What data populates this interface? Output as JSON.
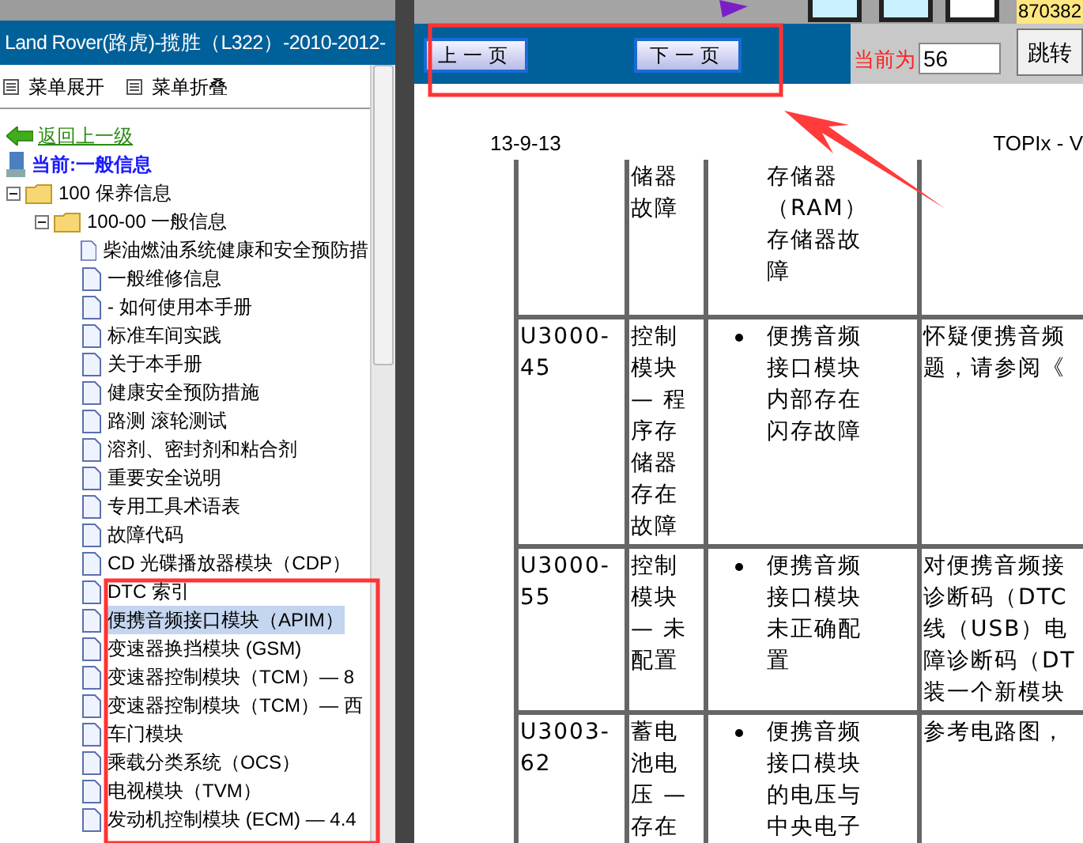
{
  "window": {
    "title": "Land Rover(路虎)-揽胜（L322）-2010-2012-"
  },
  "menu": [
    {
      "label": "菜单展开"
    },
    {
      "label": "菜单折叠"
    }
  ],
  "back_link": "返回上一级",
  "current": "当前:一般信息",
  "tree": [
    {
      "label": "100 保养信息",
      "expanded": true,
      "children": [
        {
          "label": "100-00 一般信息",
          "expanded": true,
          "children": [
            {
              "label": "柴油燃油系统健康和安全预防措",
              "selected": false
            },
            {
              "label": "一般维修信息",
              "selected": false
            },
            {
              "label": "- 如何使用本手册",
              "selected": false
            },
            {
              "label": "标准车间实践",
              "selected": false
            },
            {
              "label": "关于本手册",
              "selected": false
            },
            {
              "label": "健康安全预防措施",
              "selected": false
            },
            {
              "label": "路测 滚轮测试",
              "selected": false
            },
            {
              "label": "溶剂、密封剂和粘合剂",
              "selected": false
            },
            {
              "label": "重要安全说明",
              "selected": false
            },
            {
              "label": "专用工具术语表",
              "selected": false
            },
            {
              "label": "故障代码",
              "selected": false
            },
            {
              "label": "CD 光碟播放器模块（CDP）",
              "selected": false
            },
            {
              "label": "DTC 索引",
              "selected": false
            },
            {
              "label": "便携音频接口模块（APIM）",
              "selected": true
            },
            {
              "label": "变速器换挡模块 (GSM)",
              "selected": false
            },
            {
              "label": "变速器控制模块（TCM）— 8",
              "selected": false
            },
            {
              "label": "变速器控制模块（TCM）— 西",
              "selected": false
            },
            {
              "label": "车门模块",
              "selected": false
            },
            {
              "label": "乘载分类系统（OCS）",
              "selected": false
            },
            {
              "label": "电视模块（TVM）",
              "selected": false
            },
            {
              "label": "发动机控制模块 (ECM) — 4.4",
              "selected": false
            }
          ]
        }
      ]
    }
  ],
  "top_bar": {
    "counter": "870382"
  },
  "toolbar": {
    "prev": "上一页",
    "next": "下一页",
    "page_label": "当前为",
    "page_value": "56",
    "go": "跳转"
  },
  "document": {
    "date": "13-9-13",
    "header_right": "TOPIx - V",
    "rows": [
      {
        "column_1": [],
        "column_2": [
          "储器",
          "故障"
        ],
        "bullet": false,
        "column_3": [
          "存储器",
          "（RAM）",
          "存储器故",
          "障"
        ],
        "column_4": []
      },
      {
        "column_1": [
          "U3000-",
          "45"
        ],
        "column_2": [
          "控制",
          "模块",
          "— 程",
          "序存",
          "储器",
          "存在",
          "故障"
        ],
        "bullet": true,
        "column_3": [
          "便携音频",
          "接口模块",
          "内部存在",
          "闪存故障"
        ],
        "column_4": [
          "怀疑便携音频",
          "题，请参阅《"
        ]
      },
      {
        "column_1": [
          "U3000-",
          "55"
        ],
        "column_2": [
          "控制",
          "模块",
          "— 未",
          "配置"
        ],
        "bullet": true,
        "column_3": [
          "便携音频",
          "接口模块",
          "未正确配",
          "置"
        ],
        "column_4": [
          "对便携音频接",
          "诊断码（DTC",
          "线（USB）电",
          "障诊断码（DT",
          "装一个新模块"
        ]
      },
      {
        "column_1": [
          "U3003-",
          "62"
        ],
        "column_2": [
          "蓄电",
          "池电",
          "压 —",
          "存在"
        ],
        "bullet": true,
        "column_3": [
          "便携音频",
          "接口模块",
          "的电压与",
          "中央电子"
        ],
        "column_4": [
          "参考电路图，"
        ]
      }
    ]
  }
}
